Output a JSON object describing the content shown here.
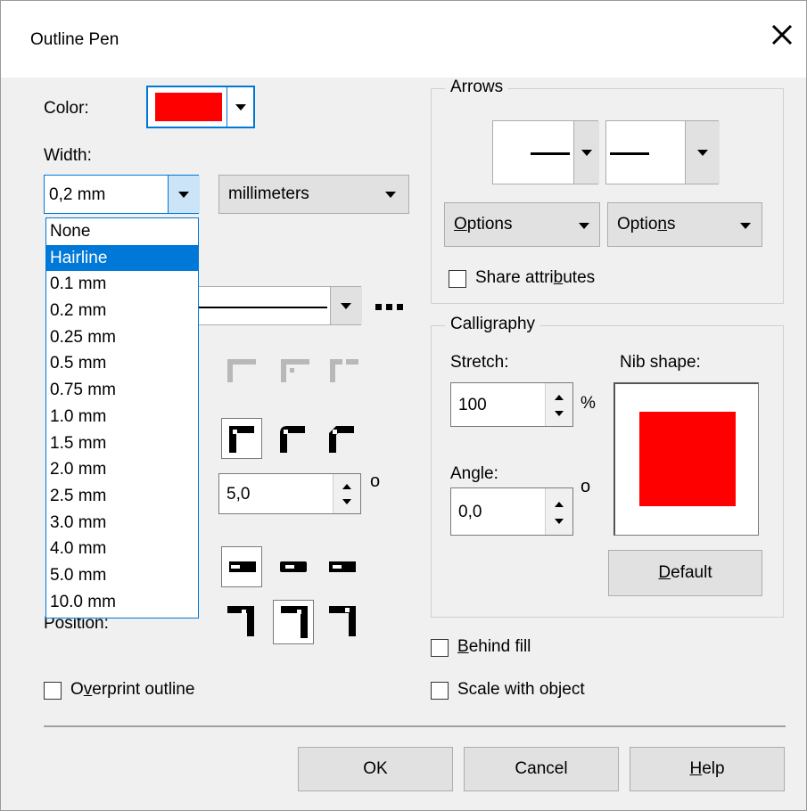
{
  "dialog": {
    "title": "Outline Pen"
  },
  "color": {
    "label": "Color:",
    "swatch": "#ff0000"
  },
  "width": {
    "label": "Width:",
    "value": "0,2 mm",
    "units": "millimeters",
    "options": [
      "None",
      "Hairline",
      "0.1 mm",
      "0.2 mm",
      "0.25 mm",
      "0.5 mm",
      "0.75 mm",
      "1.0 mm",
      "1.5 mm",
      "2.0 mm",
      "2.5 mm",
      "3.0 mm",
      "4.0 mm",
      "5.0 mm",
      "10.0 mm"
    ],
    "selected_option": "Hairline"
  },
  "miter": {
    "value": "5,0",
    "unit": "o"
  },
  "position": {
    "label": "Position:"
  },
  "overprint": {
    "pre": "O",
    "ul": "v",
    "post": "erprint outline",
    "checked": false
  },
  "arrows": {
    "legend": "Arrows",
    "options_left": {
      "pre": "",
      "ul": "O",
      "post": "ptions"
    },
    "options_right": {
      "pre": "Optio",
      "ul": "n",
      "post": "s"
    },
    "share": {
      "pre": "Share attri",
      "ul": "b",
      "post": "utes",
      "checked": false
    }
  },
  "calligraphy": {
    "legend": "Calligraphy",
    "stretch_label": "Stretch:",
    "stretch_value": "100",
    "stretch_unit": "%",
    "angle_label": "Angle:",
    "angle_value": "0,0",
    "angle_unit": "o",
    "nib_label": "Nib shape:",
    "nib_color": "#ff0000",
    "default": {
      "pre": "",
      "ul": "D",
      "post": "efault"
    }
  },
  "behind_fill": {
    "pre": "",
    "ul": "B",
    "post": "ehind fill",
    "checked": false
  },
  "scale_with_object": {
    "pre": "Scale with ob",
    "ul": "j",
    "post": "ect",
    "checked": false
  },
  "buttons": {
    "ok": "OK",
    "cancel": "Cancel",
    "help": {
      "pre": "",
      "ul": "H",
      "post": "elp"
    }
  }
}
